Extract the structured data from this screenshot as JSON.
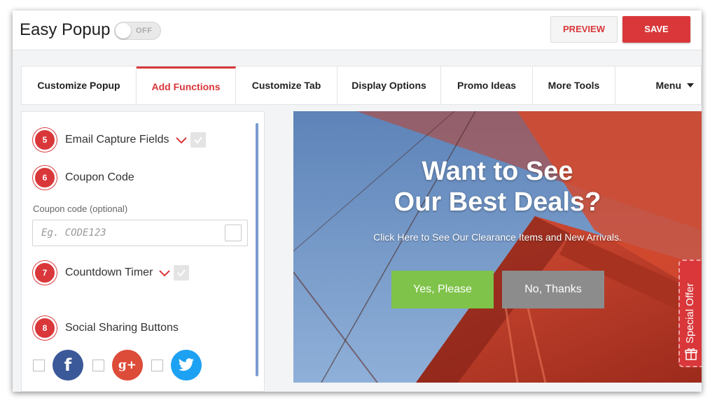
{
  "header": {
    "app_title": "Easy Popup",
    "toggle_state": "OFF",
    "preview_label": "PREVIEW",
    "save_label": "SAVE"
  },
  "tabs": [
    {
      "label": "Customize Popup",
      "active": false
    },
    {
      "label": "Add Functions",
      "active": true
    },
    {
      "label": "Customize Tab",
      "active": false
    },
    {
      "label": "Display Options",
      "active": false
    },
    {
      "label": "Promo Ideas",
      "active": false
    },
    {
      "label": "More Tools",
      "active": false
    }
  ],
  "menu_label": "Menu",
  "sidebar": {
    "steps": [
      {
        "number": "5",
        "label": "Email Capture Fields"
      },
      {
        "number": "6",
        "label": "Coupon Code"
      },
      {
        "number": "7",
        "label": "Countdown Timer"
      },
      {
        "number": "8",
        "label": "Social Sharing Buttons"
      }
    ],
    "coupon_field_label": "Coupon code (optional)",
    "coupon_placeholder": "Eg. CODE123",
    "social": [
      {
        "name": "facebook",
        "glyph": "f",
        "color": "#3b5998"
      },
      {
        "name": "google-plus",
        "glyph": "g+",
        "color": "#dd4b39"
      },
      {
        "name": "twitter",
        "glyph": "twitter",
        "color": "#1da1f2"
      }
    ]
  },
  "popup_preview": {
    "title_line1": "Want to See",
    "title_line2": "Our Best Deals?",
    "subtitle": "Click Here to See Our Clearance Items and New Arrivals.",
    "yes_label": "Yes, Please",
    "no_label": "No, Thanks",
    "side_tab_label": "Special Offer"
  },
  "colors": {
    "accent": "#d9373a",
    "yes_button": "#7fc34a",
    "no_button": "#8c8c8c"
  }
}
